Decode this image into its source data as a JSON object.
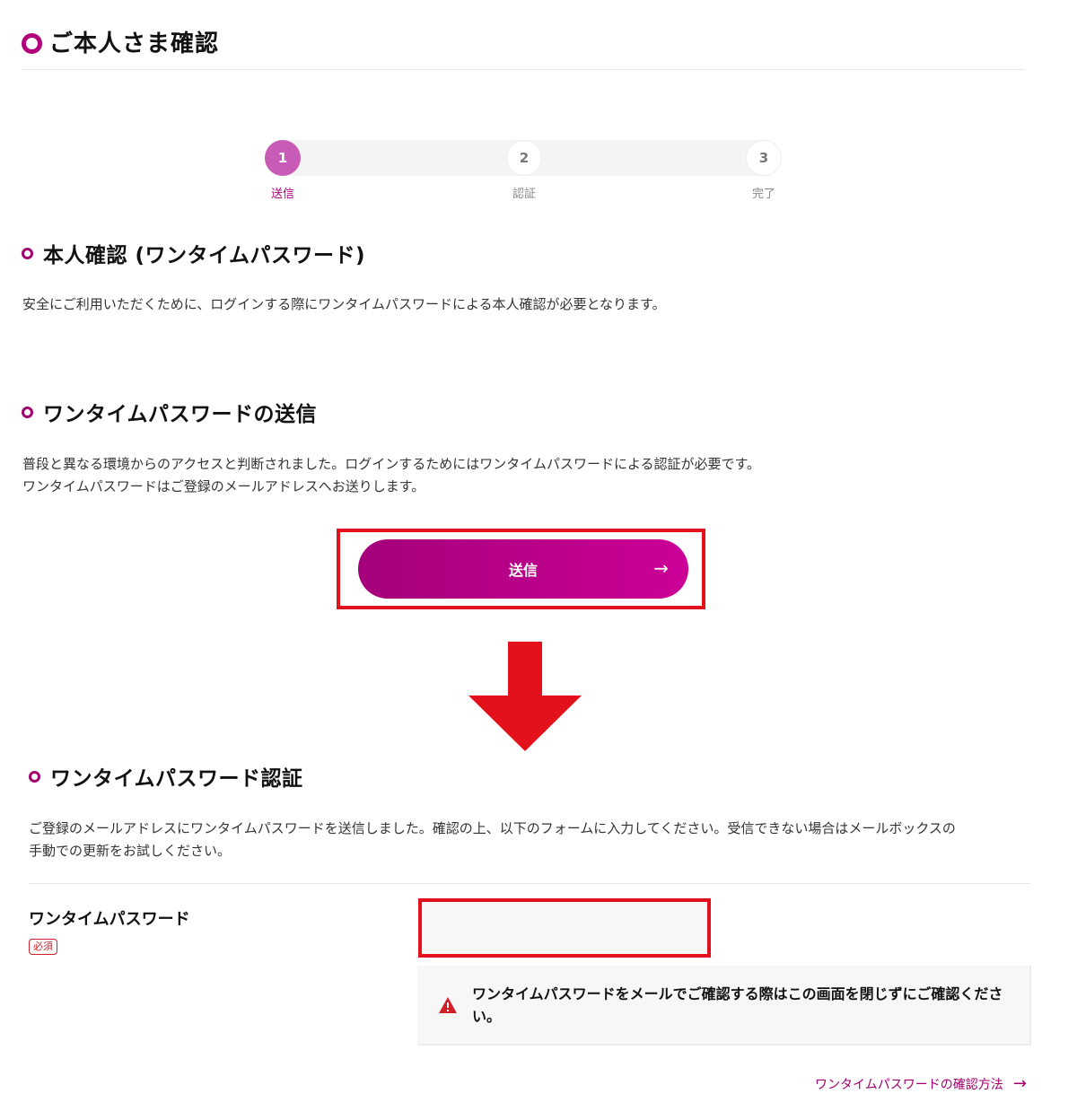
{
  "page": {
    "title": "ご本人さま確認"
  },
  "stepper": {
    "steps": [
      {
        "number": "1",
        "label": "送信",
        "state": "active"
      },
      {
        "number": "2",
        "label": "認証",
        "state": "inactive"
      },
      {
        "number": "3",
        "label": "完了",
        "state": "inactive"
      }
    ]
  },
  "identity": {
    "heading": "本人確認 (ワンタイムパスワード)",
    "description": "安全にご利用いただくために、ログインする際にワンタイムパスワードによる本人確認が必要となります。"
  },
  "send_section": {
    "heading": "ワンタイムパスワードの送信",
    "line1": "普段と異なる環境からのアクセスと判断されました。ログインするためにはワンタイムパスワードによる認証が必要です。",
    "line2": "ワンタイムパスワードはご登録のメールアドレスへお送りします。",
    "button_label": "送信",
    "button_arrow": "→"
  },
  "auth_section": {
    "heading": "ワンタイムパスワード認証",
    "line1": "ご登録のメールアドレスにワンタイムパスワードを送信しました。確認の上、以下のフォームに入力してください。受信できない場合はメールボックスの",
    "line2": "手動での更新をお試しください。",
    "field_label": "ワンタイムパスワード",
    "required_badge": "必須",
    "input_value": "",
    "input_placeholder": "",
    "notice_line1": "ワンタイムパスワードをメールでご確認する際はこの画面を閉じずにご確認くださ",
    "notice_line2": "い。",
    "help_link": "ワンタイムパスワードの確認方法",
    "help_link_arrow": "→"
  },
  "colors": {
    "brand": "#b3007a",
    "step_active": "#c75bb6",
    "highlight_red": "#e3111b",
    "warning": "#d0212b"
  },
  "icons": {
    "heading_marker": "ring-icon",
    "flow_arrow": "down-arrow-icon",
    "warning": "warning-icon",
    "button_arrow": "arrow-right-icon"
  }
}
